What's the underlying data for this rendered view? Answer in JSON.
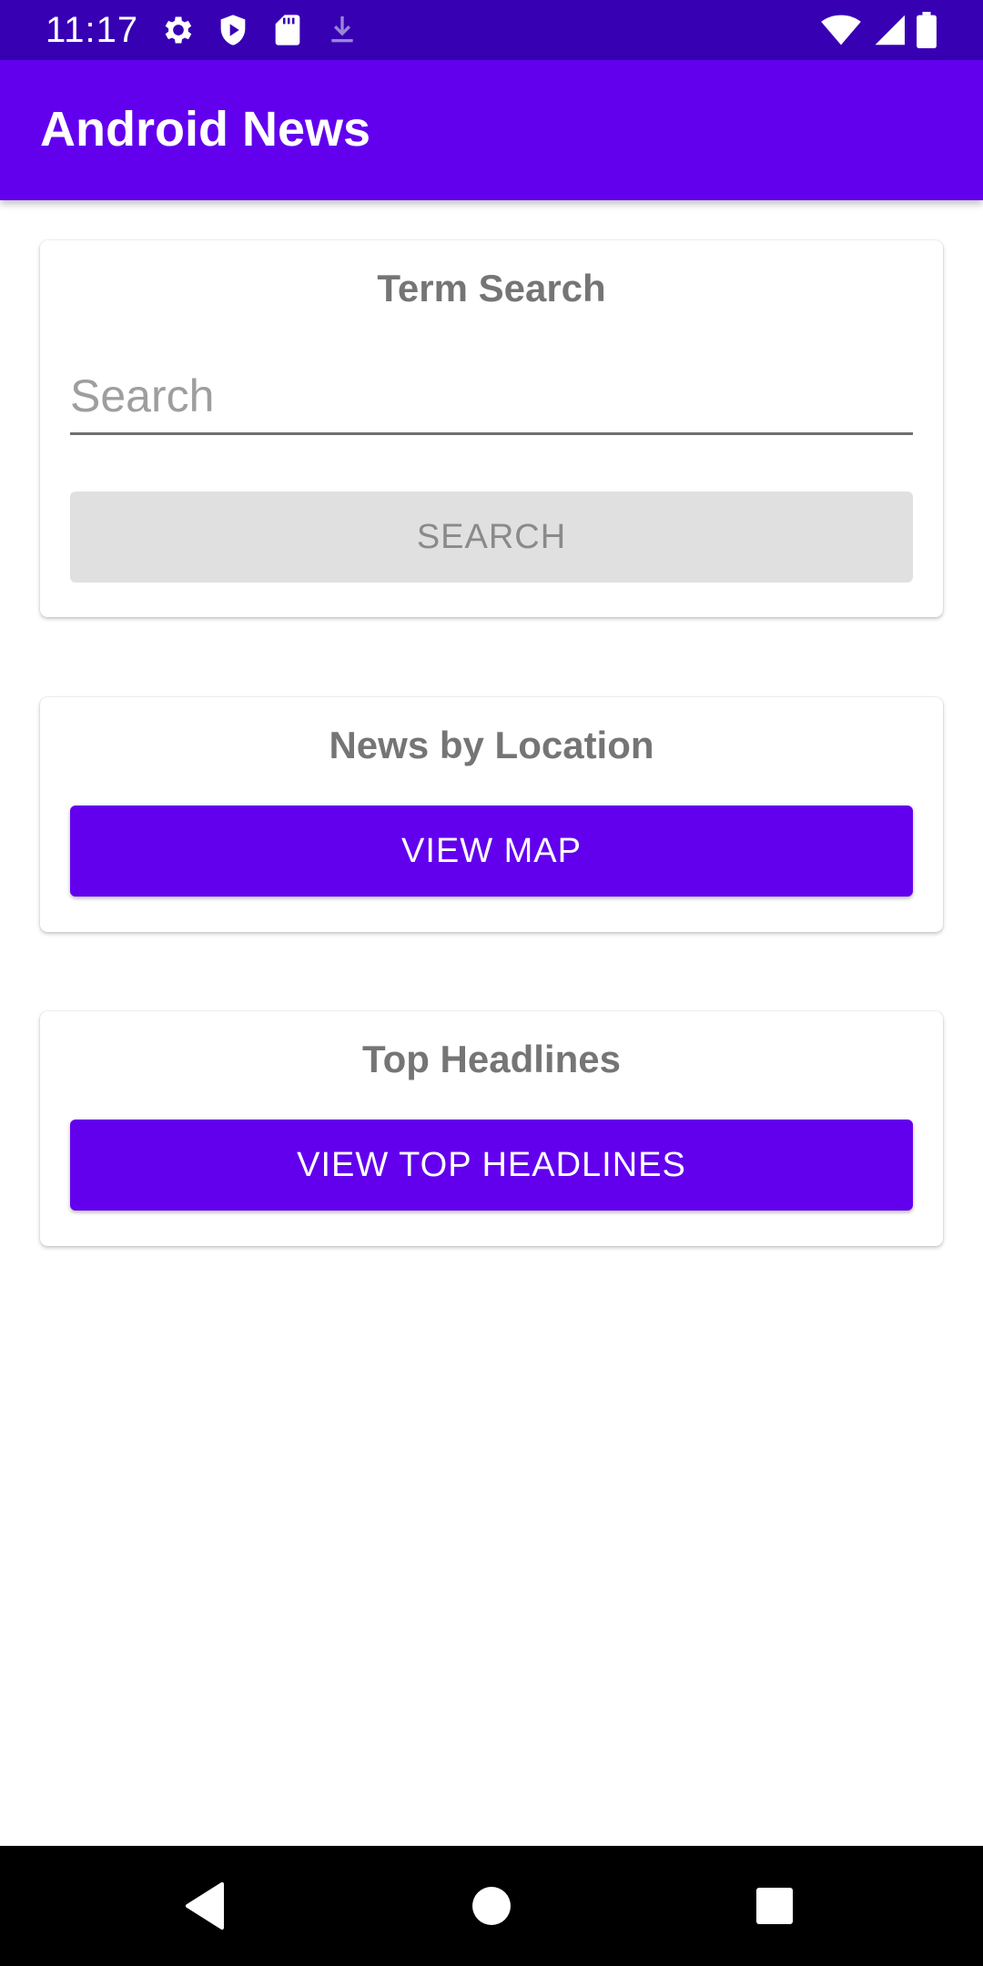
{
  "status_bar": {
    "time": "11:17",
    "icons_left": [
      "settings-icon",
      "shield-play-icon",
      "sd-card-icon",
      "download-icon"
    ],
    "icons_right": [
      "wifi-icon",
      "signal-icon",
      "battery-icon"
    ]
  },
  "app_bar": {
    "title": "Android News"
  },
  "term_search": {
    "title": "Term Search",
    "input_value": "",
    "placeholder": "Search",
    "button_label": "SEARCH"
  },
  "news_by_location": {
    "title": "News by Location",
    "button_label": "VIEW MAP"
  },
  "top_headlines": {
    "title": "Top Headlines",
    "button_label": "VIEW TOP HEADLINES"
  },
  "nav_bar": {
    "buttons": [
      "back-icon",
      "home-icon",
      "recents-icon"
    ]
  },
  "colors": {
    "status_bar": "#3700B3",
    "primary": "#6200EE",
    "card_title": "#757575",
    "disabled_button": "#E0E0E0"
  }
}
